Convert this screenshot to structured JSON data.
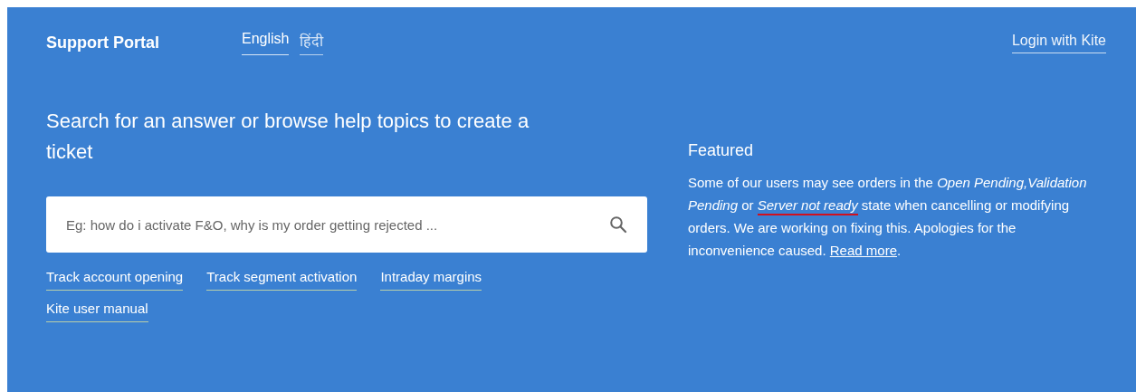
{
  "header": {
    "brand": "Support Portal",
    "languages": [
      {
        "label": "English",
        "selected": true
      },
      {
        "label": "हिंदी",
        "selected": false
      }
    ],
    "login": "Login with Kite"
  },
  "search": {
    "heading": "Search for an answer or browse help topics to create a ticket",
    "placeholder": "Eg: how do i activate F&O, why is my order getting rejected ...",
    "quick_links": [
      "Track account opening",
      "Track segment activation",
      "Intraday margins",
      "Kite user manual"
    ]
  },
  "featured": {
    "title": "Featured",
    "segments": [
      {
        "kind": "plain",
        "text": "Some of our users may see orders in the ",
        "marked": false
      },
      {
        "kind": "italic",
        "text": "Open Pending,",
        "marked": false
      },
      {
        "kind": "italic",
        "text": "Validation Pending",
        "marked": false
      },
      {
        "kind": "plain",
        "text": " or ",
        "marked": false
      },
      {
        "kind": "italic",
        "text": "Server not ready",
        "marked": true
      },
      {
        "kind": "plain",
        "text": " state when cancelling or modifying orders. We are working on fixing this. Apologies for the inconvenience caused. ",
        "marked": false
      },
      {
        "kind": "link",
        "text": "Read more",
        "marked": false
      },
      {
        "kind": "plain",
        "text": ".",
        "marked": false
      }
    ]
  }
}
